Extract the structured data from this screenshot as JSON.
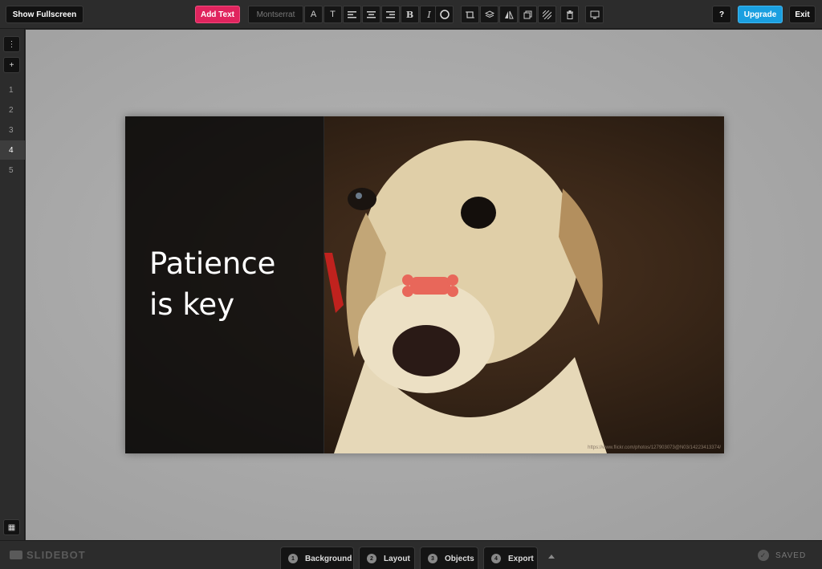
{
  "toolbar": {
    "fullscreen_label": "Show Fullscreen",
    "add_text_label": "Add Text",
    "font_name": "Montserrat",
    "bold_label": "B",
    "italic_label": "I",
    "help_label": "?",
    "upgrade_label": "Upgrade",
    "exit_label": "Exit"
  },
  "sidebar": {
    "menu_label": "⋮",
    "add_label": "+",
    "slides": [
      "1",
      "2",
      "3",
      "4",
      "5"
    ],
    "active_slide": "4",
    "grid_label": "▦"
  },
  "slide": {
    "title": "Patience\nis key",
    "photo_credit": "https://www.flickr.com/photos/127903073@N03/14223413374/"
  },
  "bottombar": {
    "logo": "SLIDEBOT",
    "steps": [
      {
        "num": "1",
        "label": "Background"
      },
      {
        "num": "2",
        "label": "Layout"
      },
      {
        "num": "3",
        "label": "Objects"
      },
      {
        "num": "4",
        "label": "Export"
      }
    ],
    "saved_label": "SAVED"
  },
  "colors": {
    "accent_pink": "#e0245e",
    "accent_blue": "#1a9fe0"
  }
}
